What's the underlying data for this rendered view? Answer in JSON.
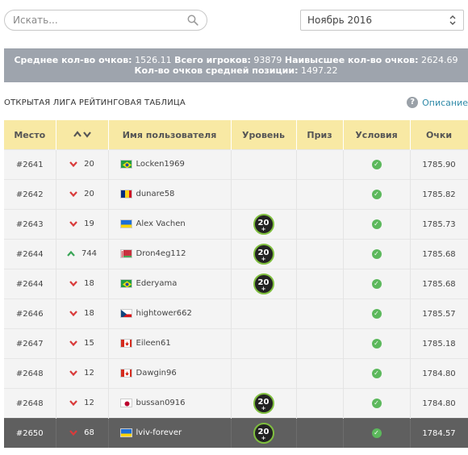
{
  "search": {
    "placeholder": "Искать...",
    "icon": "search-icon"
  },
  "month_select": {
    "value": "Ноябрь 2016"
  },
  "stats": {
    "avg_label": "Среднее кол-во очков:",
    "avg_value": "1526.11",
    "players_label": "Всего игроков:",
    "players_value": "93879",
    "max_label": "Наивысшее кол-во очков:",
    "max_value": "2624.69",
    "mid_label": "Кол-во очков средней позиции:",
    "mid_value": "1497.22"
  },
  "board": {
    "title": "ОТКРЫТАЯ ЛИГА РЕЙТИНГОВАЯ ТАБЛИЦА",
    "description_link": "Описание",
    "columns": [
      "Место",
      "",
      "Имя пользователя",
      "Уровень",
      "Приз",
      "Условия",
      "Очки"
    ],
    "rows": [
      {
        "place": "#2641",
        "dir": "down",
        "change": "20",
        "flag": "br",
        "user": "Locken1969",
        "level": "",
        "points": "1785.90"
      },
      {
        "place": "#2642",
        "dir": "down",
        "change": "20",
        "flag": "ro",
        "user": "dunare58",
        "level": "",
        "points": "1785.82"
      },
      {
        "place": "#2643",
        "dir": "down",
        "change": "19",
        "flag": "ua",
        "user": "Alex Vachen",
        "level": "20",
        "points": "1785.73"
      },
      {
        "place": "#2644",
        "dir": "up",
        "change": "744",
        "flag": "by",
        "user": "Dron4eg112",
        "level": "20",
        "points": "1785.68"
      },
      {
        "place": "#2644",
        "dir": "down",
        "change": "18",
        "flag": "br",
        "user": "Ederyama",
        "level": "20",
        "points": "1785.68"
      },
      {
        "place": "#2646",
        "dir": "down",
        "change": "18",
        "flag": "cz",
        "user": "hightower662",
        "level": "",
        "points": "1785.57"
      },
      {
        "place": "#2647",
        "dir": "down",
        "change": "15",
        "flag": "ca",
        "user": "Eileen61",
        "level": "",
        "points": "1785.18"
      },
      {
        "place": "#2648",
        "dir": "down",
        "change": "12",
        "flag": "ca",
        "user": "Dawgin96",
        "level": "",
        "points": "1784.80"
      },
      {
        "place": "#2648",
        "dir": "down",
        "change": "12",
        "flag": "jp",
        "user": "bussan0916",
        "level": "20",
        "points": "1784.80"
      },
      {
        "place": "#2650",
        "dir": "down",
        "change": "68",
        "flag": "ua",
        "user": "lviv-forever",
        "level": "20",
        "points": "1784.57",
        "current": true
      }
    ]
  }
}
